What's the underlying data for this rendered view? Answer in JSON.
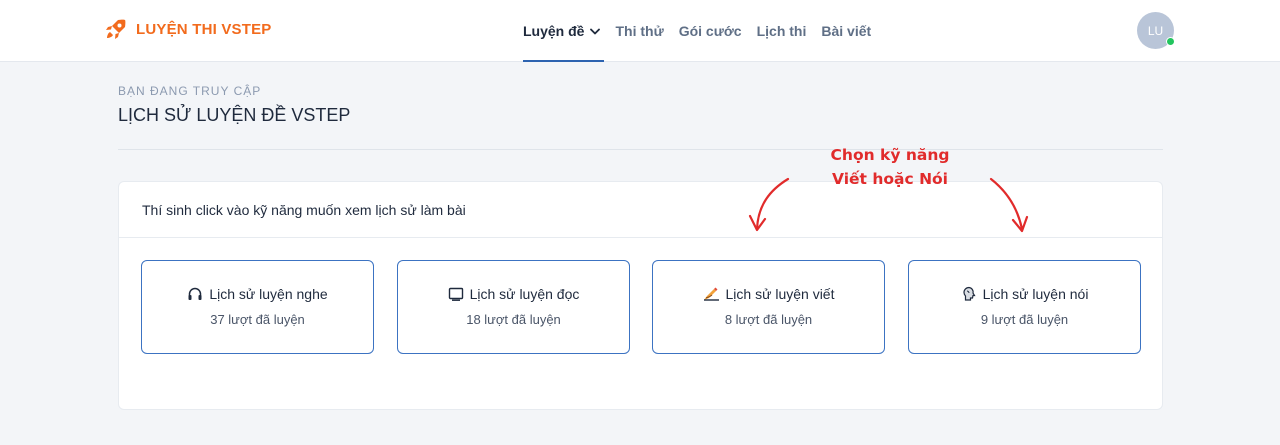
{
  "header": {
    "brand": "LUYỆN THI VSTEP",
    "nav": [
      {
        "label": "Luyện đề",
        "active": true,
        "dropdown": true
      },
      {
        "label": "Thi thử"
      },
      {
        "label": "Gói cước"
      },
      {
        "label": "Lịch thi"
      },
      {
        "label": "Bài viết"
      }
    ],
    "avatar_initials": "LU",
    "online_status_color": "#22c55e"
  },
  "page": {
    "breadcrumb": "BẠN ĐANG TRUY CẬP",
    "title": "LỊCH SỬ LUYỆN ĐỀ VSTEP"
  },
  "card": {
    "instruction": "Thí sinh click vào kỹ năng muốn xem lịch sử làm bài",
    "skills": [
      {
        "icon": "headphones-icon",
        "label": "Lịch sử luyện nghe",
        "count": "37 lượt đã luyện"
      },
      {
        "icon": "book-icon",
        "label": "Lịch sử luyện đọc",
        "count": "18 lượt đã luyện"
      },
      {
        "icon": "writing-hand-icon",
        "label": "Lịch sử luyện viết",
        "count": "8 lượt đã luyện"
      },
      {
        "icon": "speaking-head-icon",
        "label": "Lịch sử luyện nói",
        "count": "9 lượt đã luyện"
      }
    ]
  },
  "annotation": {
    "line1": "Chọn kỹ năng",
    "line2": "Viết hoặc Nói",
    "color": "#e12b2b"
  },
  "colors": {
    "brand": "#f26b1d",
    "accent": "#3c73c2",
    "background": "#f3f5f8"
  }
}
